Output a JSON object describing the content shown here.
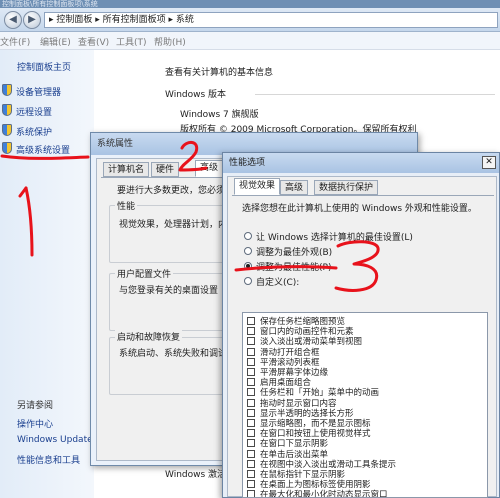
{
  "colors": {
    "link": "#1a3f8f",
    "annotation": "#e8121b",
    "dialog_title": "#b7cde8"
  },
  "window": {
    "title": "控制面板\\所有控制面板项\\系统",
    "address": "▸ 控制面板 ▸ 所有控制面板项 ▸ 系统"
  },
  "menu": [
    "文件(F)",
    "编辑(E)",
    "查看(V)",
    "工具(T)",
    "帮助(H)"
  ],
  "sidebar": {
    "home": "控制面板主页",
    "items": [
      {
        "label": "设备管理器",
        "icon": "shield-icon"
      },
      {
        "label": "远程设置",
        "icon": "shield-icon"
      },
      {
        "label": "系统保护",
        "icon": "shield-icon"
      },
      {
        "label": "高级系统设置",
        "icon": "shield-icon"
      }
    ],
    "see_also_title": "另请参阅",
    "see_also": [
      "操作中心",
      "Windows Update",
      "性能信息和工具"
    ]
  },
  "main": {
    "heading": "查看有关计算机的基本信息",
    "version_section": "Windows 版本",
    "edition": "Windows 7 旗舰版",
    "copyright": "版权所有 © 2009 Microsoft Corporation。保留所有权利",
    "activation": "Windows 激活"
  },
  "system_properties": {
    "title": "系统属性",
    "tabs": [
      "计算机名",
      "硬件",
      "高级"
    ],
    "active_tab": "高级",
    "intro": "要进行大多数更改，您必须作为管理员登录。",
    "performance_group": "性能",
    "performance_desc": "视觉效果，处理器计划，内存使用，以及虚拟内存",
    "profile_group": "用户配置文件",
    "profile_desc": "与您登录有关的桌面设置",
    "startup_group": "启动和故障恢复",
    "startup_desc": "系统启动、系统失败和调试信息"
  },
  "performance_options": {
    "title": "性能选项",
    "close_glyph": "✕",
    "tabs": [
      "视觉效果",
      "高级",
      "数据执行保护"
    ],
    "active_tab": "视觉效果",
    "instruction": "选择您想在此计算机上使用的 Windows 外观和性能设置。",
    "options": [
      {
        "label": "让 Windows 选择计算机的最佳设置(L)",
        "selected": false
      },
      {
        "label": "调整为最佳外观(B)",
        "selected": false
      },
      {
        "label": "调整为最佳性能(P)",
        "selected": true
      },
      {
        "label": "自定义(C):",
        "selected": false
      }
    ],
    "effects": [
      "保存任务栏缩略图预览",
      "窗口内的动画控件和元素",
      "淡入淡出或滑动菜单到视图",
      "滑动打开组合框",
      "平滑滚动列表框",
      "平滑屏幕字体边缘",
      "启用桌面组合",
      "任务栏和「开始」菜单中的动画",
      "拖动时显示窗口内容",
      "显示半透明的选择长方形",
      "显示缩略图，而不是显示图标",
      "在窗口和按钮上使用视觉样式",
      "在窗口下显示阴影",
      "在单击后淡出菜单",
      "在视图中淡入淡出或滑动工具条提示",
      "在鼠标指针下显示阴影",
      "在桌面上为图标标签使用阴影",
      "在最大化和最小化时动态显示窗口"
    ]
  },
  "annotations": [
    "1",
    "2",
    "3"
  ]
}
